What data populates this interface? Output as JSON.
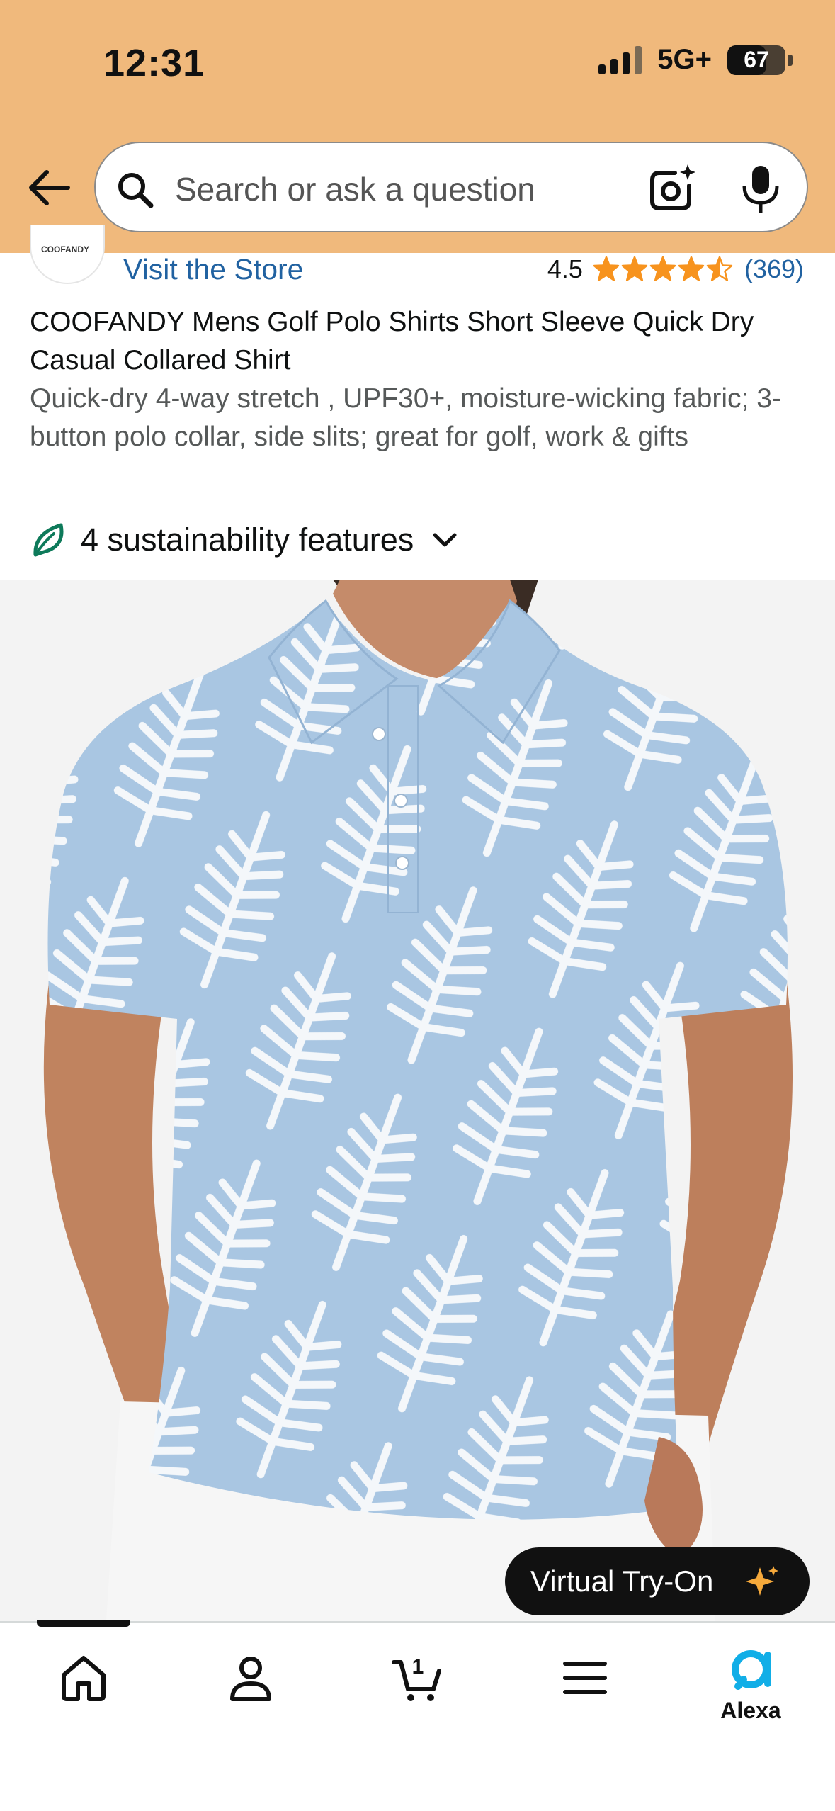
{
  "status_bar": {
    "time": "12:31",
    "network": "5G+",
    "battery": "67",
    "battery_level": 0.67
  },
  "search": {
    "placeholder": "Search or ask a question"
  },
  "product": {
    "store_link": "Visit the Store",
    "rating": "4.5",
    "rating_value": 4.5,
    "review_count": "(369)",
    "title": "COOFANDY Mens Golf Polo Shirts Short Sleeve Quick Dry Casual Collared Shirt",
    "subtitle": "Quick-dry 4-way stretch , UPF30+, moisture-wicking fabric; 3-button polo collar, side slits; great for golf, work & gifts",
    "sustainability": "4 sustainability features",
    "virtual_tryon": "Virtual Try-On"
  },
  "bottom_nav": {
    "items": [
      {
        "icon": "home-icon"
      },
      {
        "icon": "account-icon"
      },
      {
        "icon": "cart-icon",
        "badge": "1"
      },
      {
        "icon": "menu-icon"
      },
      {
        "icon": "alexa-icon",
        "label": "Alexa"
      }
    ]
  },
  "colors": {
    "header": "#f0b97c",
    "link": "#2162a1",
    "star": "#f7931e",
    "shirt_blue": "#a9c6e2",
    "tryon_bg": "#111111",
    "alexa_blue": "#11aee7"
  }
}
